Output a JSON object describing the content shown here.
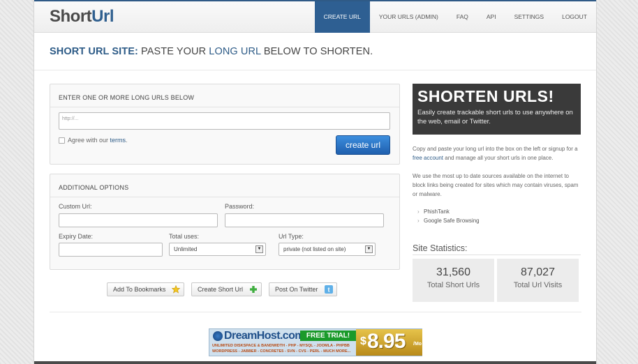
{
  "logo": {
    "part1": "Short",
    "part2": "Url"
  },
  "nav": [
    {
      "label": "CREATE URL",
      "active": true
    },
    {
      "label": "YOUR URLS (ADMIN)",
      "active": false
    },
    {
      "label": "FAQ",
      "active": false
    },
    {
      "label": "API",
      "active": false
    },
    {
      "label": "SETTINGS",
      "active": false
    },
    {
      "label": "LOGOUT",
      "active": false
    }
  ],
  "headline": {
    "strong": "SHORT URL SITE:",
    "pre": " PASTE YOUR ",
    "highlight": "LONG URL",
    "post": " BELOW TO SHORTEN."
  },
  "shorten_panel": {
    "title": "ENTER ONE OR MORE LONG URLS BELOW",
    "url_placeholder": "http://...",
    "agree_text": "Agree with our ",
    "terms_link": "terms",
    "agree_end": ".",
    "create_button": "create url"
  },
  "options_panel": {
    "title": "ADDITIONAL OPTIONS",
    "custom_url_label": "Custom Url:",
    "password_label": "Password:",
    "expiry_label": "Expiry Date:",
    "total_uses_label": "Total uses:",
    "total_uses_value": "Unlimited",
    "url_type_label": "Url Type:",
    "url_type_value": "private (not listed on site)"
  },
  "actions": {
    "bookmarks": "Add To Bookmarks",
    "create_short": "Create Short Url",
    "twitter": "Post On Twitter"
  },
  "banner": {
    "brand": "DreamHost.com",
    "trial": "FREE TRIAL!",
    "line1": "UNLIMITED DISKSPACE & BANDWIDTH - PHP - MYSQL - JOOMLA - PHPBB",
    "line2": "WORDPRESS - JABBER - CONCRETE5 - SVN - CVS - PERL - MUCH MORE...",
    "dollar": "$",
    "price": "8.95",
    "per": "/Mo"
  },
  "sidebar": {
    "promo_title": "SHORTEN URLS!",
    "promo_desc": "Easily create trackable short urls to use anywhere on the web, email or Twitter.",
    "p1_pre": "Copy and paste your long url into the box on the left or signup for a ",
    "p1_link": "free account",
    "p1_post": " and manage all your short urls in one place.",
    "p2": "We use the most up to date sources available on the internet to block links being created for sites which may contain viruses, spam or malware.",
    "sources": [
      "PhishTank",
      "Google Safe Browsing"
    ],
    "stats_title": "Site Statistics:",
    "stats": [
      {
        "number": "31,560",
        "label": "Total Short Urls"
      },
      {
        "number": "87,027",
        "label": "Total Url Visits"
      }
    ]
  }
}
